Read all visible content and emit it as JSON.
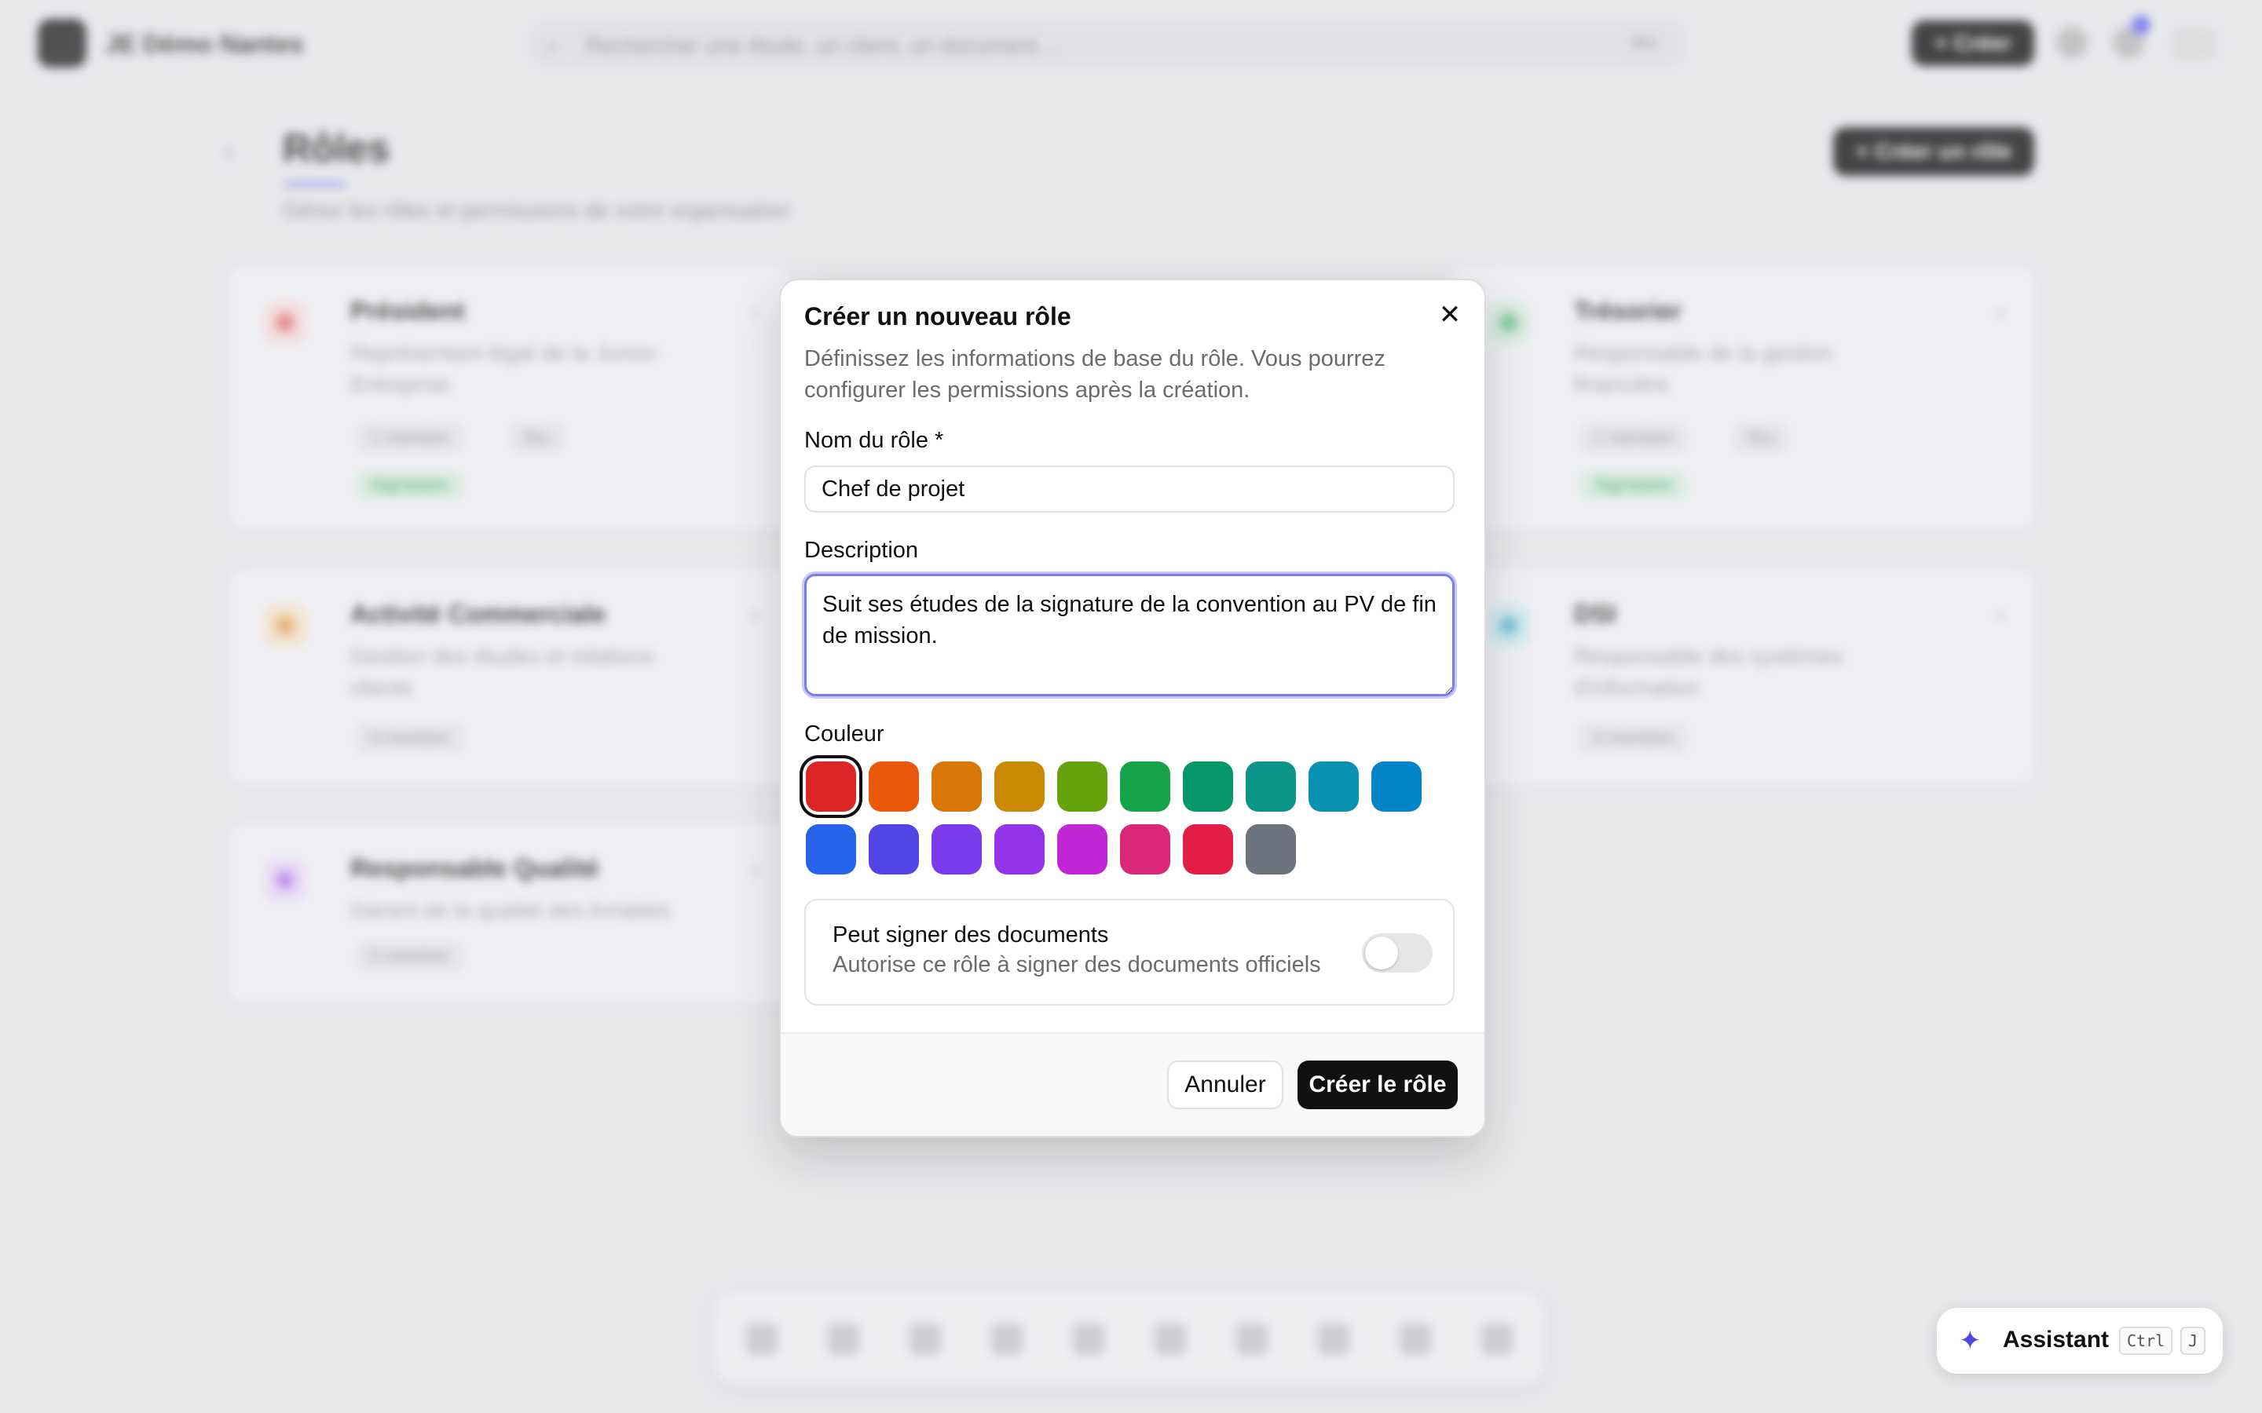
{
  "app": {
    "org_name": "JE Démo Nantes",
    "search_placeholder": "Rechercher une étude, un client, un document…",
    "search_shortcut": "⌘K",
    "create_label": "+ Créer"
  },
  "page": {
    "title": "Rôles",
    "subtitle": "Gérez les rôles et permissions de votre organisation",
    "create_role_label": "+ Créer un rôle"
  },
  "roles": [
    {
      "name": "Président",
      "description": "Représentant légal de la Junior-Entreprise",
      "members": "1 membre",
      "extra": "Élu",
      "signatory": "Signataire",
      "color": "#dc2626"
    },
    {
      "name": "Trésorier",
      "description": "Responsable de la gestion financière",
      "members": "1 membre",
      "extra": "Élu",
      "signatory": "Signataire",
      "color": "#16a34a"
    },
    {
      "name": "Activité Commerciale",
      "description": "Gestion des études et relations clients",
      "members": "0 membre",
      "color": "#d97706"
    },
    {
      "name": "DSI",
      "description": "Responsable des systèmes d'information",
      "members": "0 membre",
      "color": "#0891b2"
    },
    {
      "name": "Responsable Qualité",
      "description": "Garant de la qualité des livrables",
      "members": "0 membre",
      "color": "#9333ea"
    }
  ],
  "modal": {
    "title": "Créer un nouveau rôle",
    "description": "Définissez les informations de base du rôle. Vous pourrez configurer les permissions après la création.",
    "name_label": "Nom du rôle *",
    "name_value": "Chef de projet",
    "description_label": "Description",
    "description_value": "Suit ses études de la signature de la convention au PV de fin de mission.",
    "color_label": "Couleur",
    "colors": [
      "#dc2626",
      "#ea580c",
      "#d97706",
      "#ca8a04",
      "#65a30d",
      "#16a34a",
      "#059669",
      "#0d9488",
      "#0891b2",
      "#0284c7",
      "#2563eb",
      "#4f46e5",
      "#7c3aed",
      "#9333ea",
      "#c026d3",
      "#db2777",
      "#e11d48",
      "#6b7280"
    ],
    "selected_color": "#dc2626",
    "can_sign_title": "Peut signer des documents",
    "can_sign_description": "Autorise ce rôle à signer des documents officiels",
    "can_sign_enabled": false,
    "cancel_label": "Annuler",
    "submit_label": "Créer le rôle",
    "close_icon": "close-icon"
  },
  "assistant": {
    "label": "Assistant",
    "shortcut_ctrl": "Ctrl",
    "shortcut_key": "J",
    "icon": "sparkles-icon"
  }
}
